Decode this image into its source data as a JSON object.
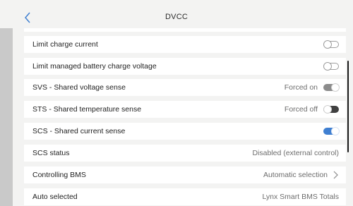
{
  "header": {
    "title": "DVCC"
  },
  "rows": [
    {
      "label": "Limit charge current"
    },
    {
      "label": "Limit managed battery charge voltage"
    },
    {
      "label": "SVS - Shared voltage sense",
      "value": "Forced on"
    },
    {
      "label": "STS - Shared temperature sense",
      "value": "Forced off"
    },
    {
      "label": "SCS - Shared current sense"
    },
    {
      "label": "SCS status",
      "value": "Disabled (external control)"
    },
    {
      "label": "Controlling BMS",
      "value": "Automatic selection"
    },
    {
      "label": "Auto selected",
      "value": "Lynx Smart BMS Totals"
    }
  ],
  "toggles": {
    "limit_charge_current": false,
    "limit_managed_battery_charge_voltage": false,
    "svs": true,
    "sts": false,
    "scs": true
  },
  "colors": {
    "accent": "#3f7fd1",
    "background": "#f3f3f2",
    "row": "#ffffff"
  },
  "icons": {
    "back": "chevron-left-icon",
    "navigate": "chevron-right-icon"
  }
}
